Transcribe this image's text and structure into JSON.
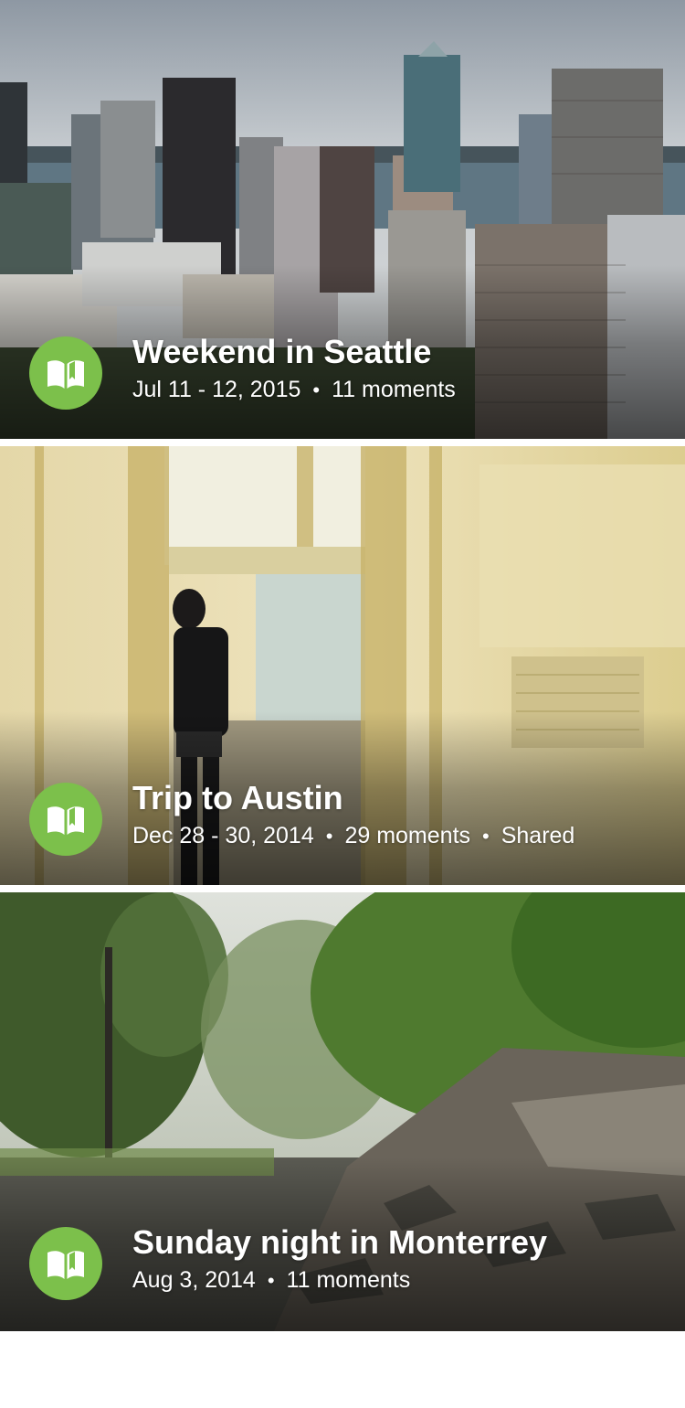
{
  "colors": {
    "story_icon_bg": "#7cc04b",
    "background": "#ffffff",
    "overlay_text": "#ffffff"
  },
  "stories": [
    {
      "title": "Weekend in Seattle",
      "date": "Jul 11 - 12, 2015",
      "moments": "11 moments",
      "icon": "book-icon"
    },
    {
      "title": "Trip to Austin",
      "date": "Dec 28 - 30, 2014",
      "moments": "29 moments",
      "shared": "Shared",
      "icon": "book-icon"
    },
    {
      "title": "Sunday night in Monterrey",
      "date": "Aug 3, 2014",
      "moments": "11 moments",
      "icon": "book-icon"
    }
  ]
}
